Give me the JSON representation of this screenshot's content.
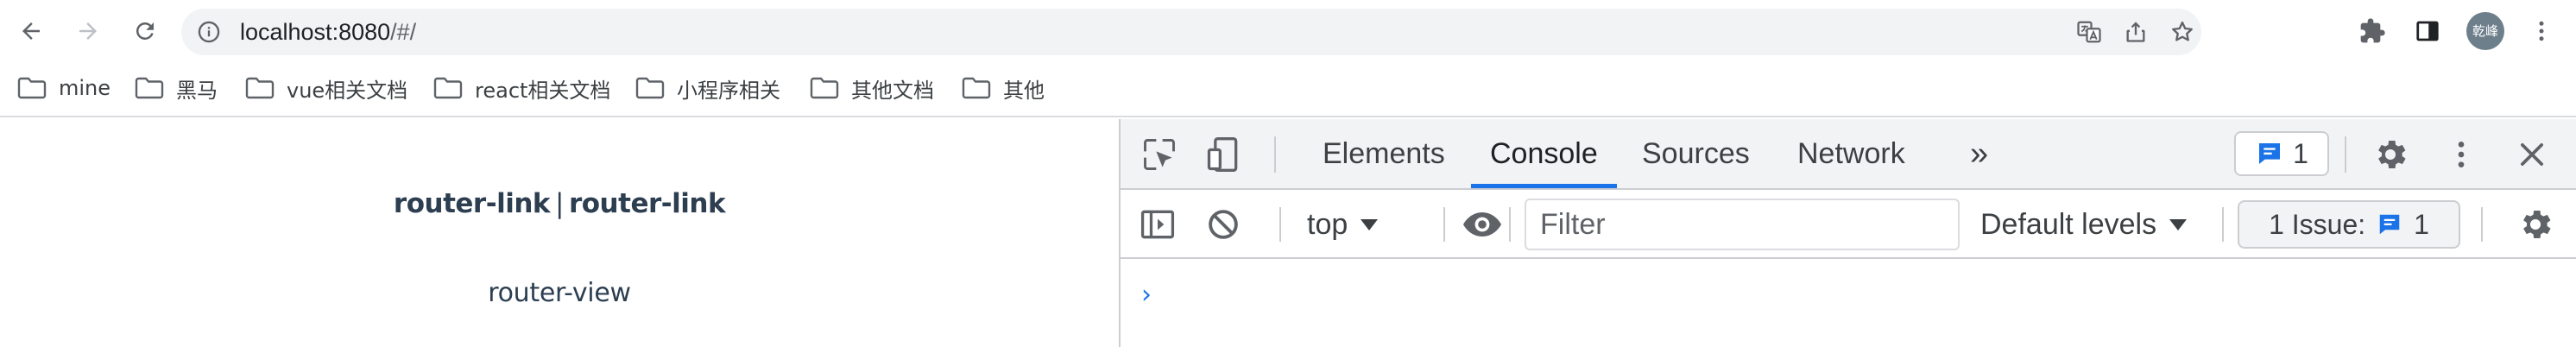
{
  "browser": {
    "url_host": "localhost:8080",
    "url_path": "/#/",
    "profile_label": "乾峰"
  },
  "bookmarks": [
    {
      "label": "mine"
    },
    {
      "label": "黑马"
    },
    {
      "label": "vue相关文档"
    },
    {
      "label": "react相关文档"
    },
    {
      "label": "小程序相关"
    },
    {
      "label": "其他文档"
    },
    {
      "label": "其他"
    }
  ],
  "page": {
    "link_1": "router-link",
    "separator": "|",
    "link_2": "router-link",
    "router_view": "router-view"
  },
  "devtools": {
    "tabs": [
      "Elements",
      "Console",
      "Sources",
      "Network"
    ],
    "active_tab": "Console",
    "more_tabs": "»",
    "message_count": "1",
    "context": "top",
    "filter_placeholder": "Filter",
    "levels_label": "Default levels",
    "issues_label": "1 Issue:",
    "issues_count": "1",
    "prompt": "›"
  },
  "colors": {
    "accent": "#1a73e8",
    "page_text": "#2c3e50",
    "toolbar_bg": "#f1f3f4"
  },
  "icons": {
    "back": "arrow-left-icon",
    "forward": "arrow-right-icon",
    "reload": "reload-icon",
    "site_info": "info-icon",
    "translate": "translate-icon",
    "share": "share-icon",
    "bookmark": "star-icon",
    "extensions": "puzzle-icon",
    "side_panel": "side-panel-icon",
    "menu": "kebab-icon",
    "folder": "folder-icon",
    "inspect": "inspect-element-icon",
    "device": "device-toolbar-icon",
    "settings": "gear-icon",
    "close": "close-icon",
    "sidebar": "sidebar-toggle-icon",
    "clear": "clear-console-icon",
    "eye": "eye-icon",
    "message": "message-icon"
  }
}
